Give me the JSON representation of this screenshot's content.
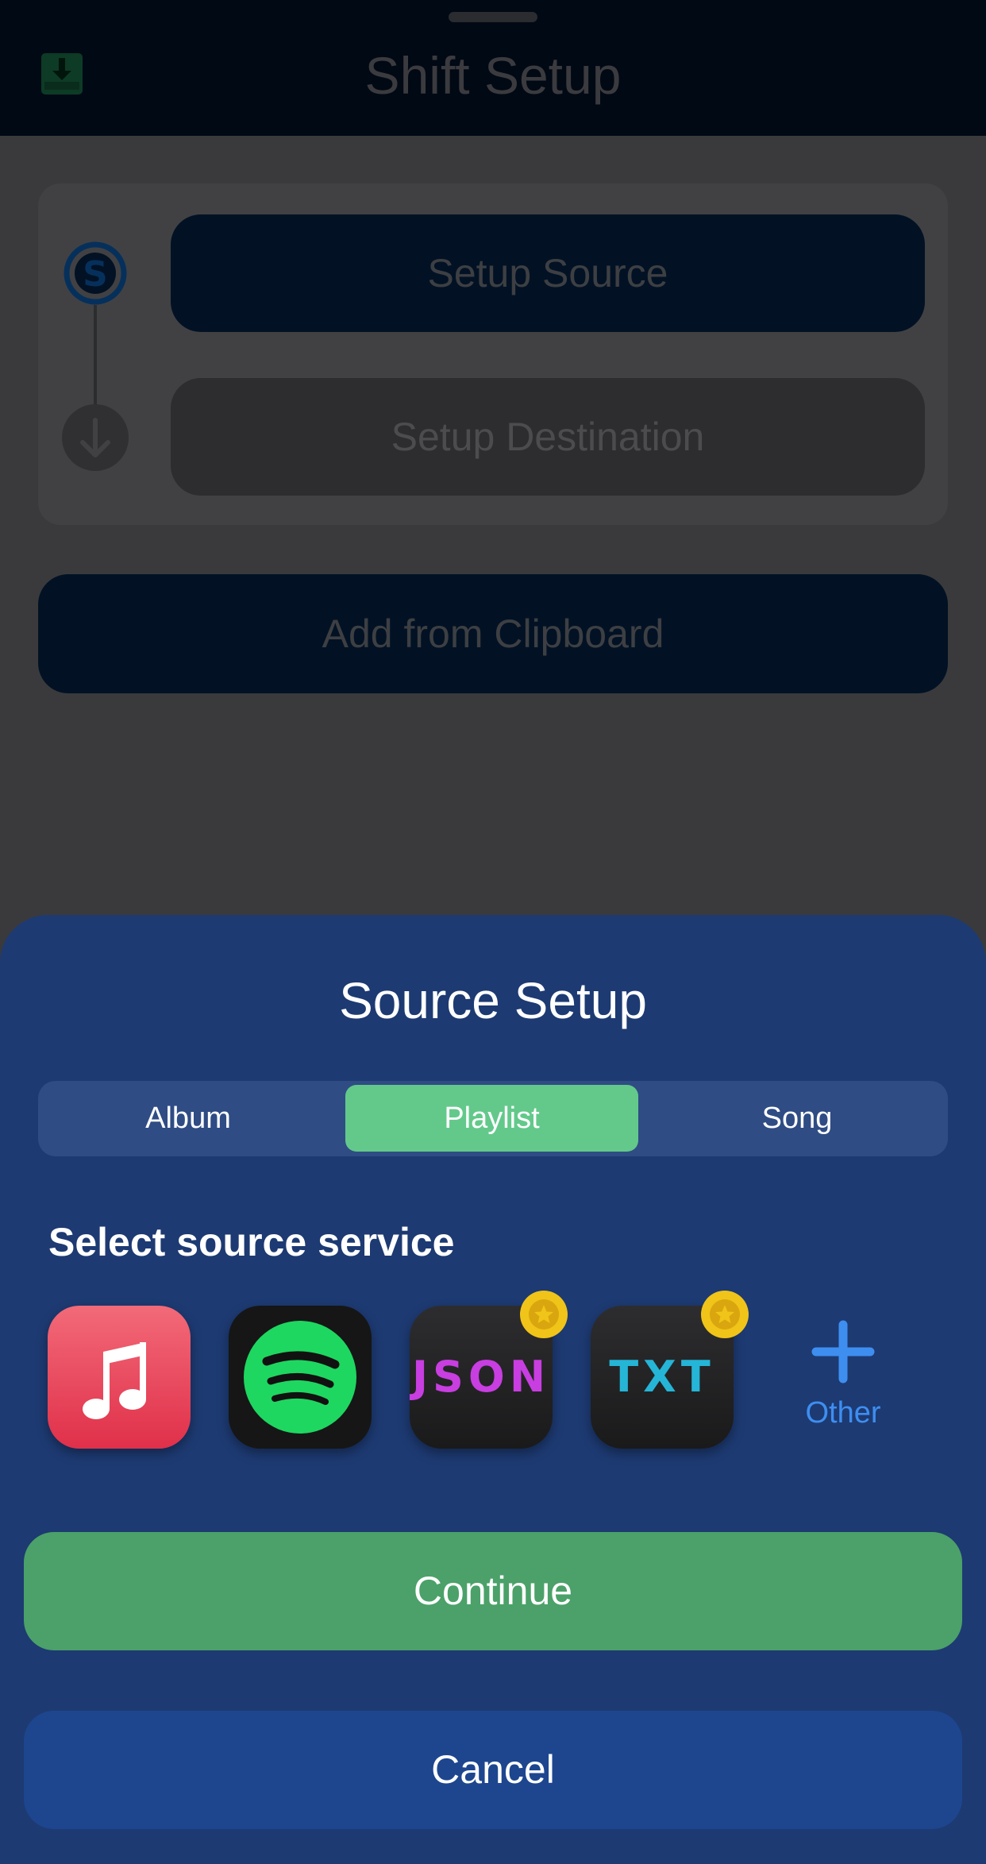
{
  "header": {
    "title": "Shift Setup",
    "save_icon": "download-save-icon"
  },
  "steps": {
    "source_label": "Setup Source",
    "destination_label": "Setup Destination",
    "source_icon": "source-s-icon",
    "destination_icon": "arrow-down-icon"
  },
  "clipboard": {
    "label": "Add from Clipboard"
  },
  "sheet": {
    "title": "Source Setup",
    "segments": [
      "Album",
      "Playlist",
      "Song"
    ],
    "selected_segment": "Playlist",
    "section_label": "Select source service",
    "services": [
      {
        "name": "apple-music",
        "icon": "music-note-icon"
      },
      {
        "name": "spotify",
        "icon": "spotify-icon"
      },
      {
        "name": "json",
        "text": "JSON",
        "badge": "premium-badge-icon"
      },
      {
        "name": "txt",
        "text": "TXT",
        "badge": "premium-badge-icon"
      }
    ],
    "other_label": "Other",
    "continue_label": "Continue",
    "cancel_label": "Cancel"
  },
  "colors": {
    "sheet_background": "#1d3a72",
    "selected_segment": "#63c98b",
    "continue": "#4ba169",
    "cancel": "#1d468f",
    "accent": "#3e8ef0"
  }
}
